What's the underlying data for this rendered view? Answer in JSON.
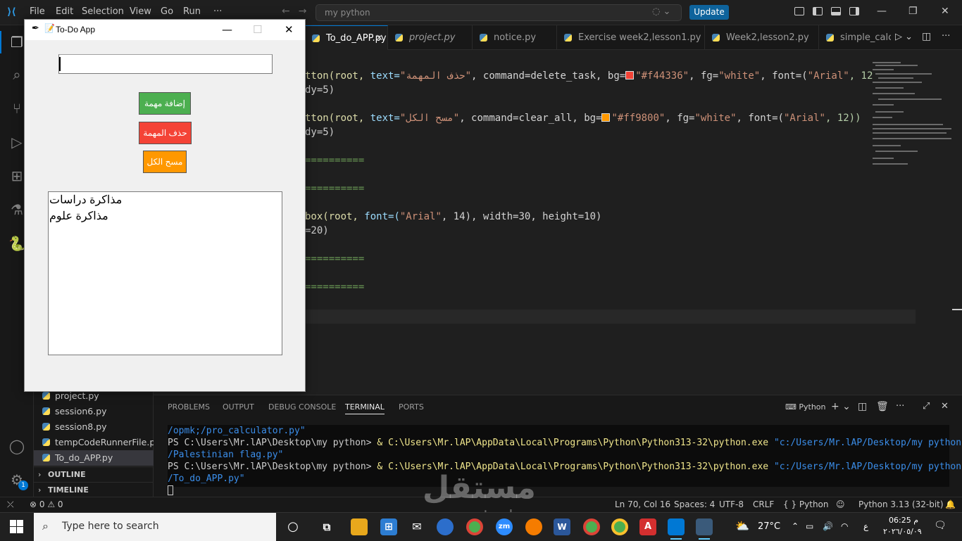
{
  "titlebar": {
    "menu": [
      "File",
      "Edit",
      "Selection",
      "View",
      "Go",
      "Run",
      "···"
    ],
    "command_center": "my python",
    "update_label": "Update"
  },
  "tabs": [
    {
      "label": "To_do_APP.py",
      "active": true
    },
    {
      "label": "project.py",
      "active": false
    },
    {
      "label": "notice.py",
      "active": false
    },
    {
      "label": "Exercise week2,lesson1.py",
      "active": false
    },
    {
      "label": "Week2,lesson2.py",
      "active": false
    },
    {
      "label": "simple_calc",
      "active": false
    }
  ],
  "editor": {
    "line1_a": "tton(root, ",
    "line1_b": "text=",
    "line1_c": "\"حذف المهمة\"",
    "line1_d": ", command=delete_task, bg=",
    "line1_e": "\"#f44336\"",
    "line1_f": ", fg=",
    "line1_g": "\"white\"",
    "line1_h": ", font=(",
    "line1_i": "\"Arial\"",
    "line1_j": ", 12",
    "line2": "dy=5)",
    "line3_a": "tton(root, ",
    "line3_b": "text=",
    "line3_c": "\"مسح الكل\"",
    "line3_d": ", command=clear_all, bg=",
    "line3_e": "\"#ff9800\"",
    "line3_f": ", fg=",
    "line3_g": "\"white\"",
    "line3_h": ", font=(",
    "line3_i": "\"Arial\"",
    "line3_j": ", 12))",
    "line4": "dy=5)",
    "sep1": "==========",
    "sep2": "==========",
    "line5_a": "box(root, ",
    "line5_b": "font=(",
    "line5_c": "\"Arial\"",
    "line5_d": ", 14), width=30, height=10)",
    "line6": "=20)",
    "sep3": "==========",
    "sep4": "==========",
    "swatch_red": "#f44336",
    "swatch_orange": "#ff9800"
  },
  "sidebar": {
    "files": [
      {
        "label": "project.py",
        "active": false
      },
      {
        "label": "session6.py",
        "active": false
      },
      {
        "label": "session8.py",
        "active": false
      },
      {
        "label": "tempCodeRunnerFile.py",
        "active": false
      },
      {
        "label": "To_do_APP.py",
        "active": true
      }
    ],
    "outline": "OUTLINE",
    "timeline": "TIMELINE"
  },
  "panel": {
    "tabs": [
      "PROBLEMS",
      "OUTPUT",
      "DEBUG CONSOLE",
      "TERMINAL",
      "PORTS"
    ],
    "active_tab": "TERMINAL",
    "shell": "Python",
    "terminal": {
      "l1": "/opmk;/pro_calculator.py\"",
      "l2_prompt": "PS C:\\Users\\Mr.lAP\\Desktop\\my python> ",
      "l2_amp": "& ",
      "l2_exe": "C:\\Users\\Mr.lAP\\AppData\\Local\\Programs\\Python\\Python313-32\\python.exe",
      "l2_arg": " \"c:/Users/Mr.lAP/Desktop/my python",
      "l3": "/Palestinian flag.py\"",
      "l4_prompt": "PS C:\\Users\\Mr.lAP\\Desktop\\my python> ",
      "l4_amp": "& ",
      "l4_exe": "C:\\Users\\Mr.lAP\\AppData\\Local\\Programs\\Python\\Python313-32\\python.exe",
      "l4_arg": " \"c:/Users/Mr.lAP/Desktop/my python",
      "l5": "/To_do_APP.py\""
    }
  },
  "statusbar": {
    "errors": "0",
    "warnings": "0",
    "position": "Ln 70, Col 16",
    "spaces": "Spaces: 4",
    "encoding": "UTF-8",
    "eol": "CRLF",
    "language": "Python",
    "interpreter": "Python 3.13 (32-bit)"
  },
  "todo_app": {
    "title": "To-Do App",
    "entry_value": "",
    "buttons": {
      "add": "إضافة مهمة",
      "delete": "حذف المهمة",
      "clear": "مسح الكل"
    },
    "colors": {
      "add": "#4caf50",
      "delete": "#f44336",
      "clear": "#ff9800"
    },
    "tasks": [
      "مذاكرة دراسات",
      "مذاكرة علوم"
    ]
  },
  "watermark": {
    "main": "مستقل",
    "sub": "mostaql.com"
  },
  "taskbar": {
    "search_placeholder": "Type here to search",
    "weather": "27°C",
    "ime": "ع",
    "time": "06:25 م",
    "date": "٢٠٢٦/٠٥/٠٩",
    "badge": "1"
  }
}
